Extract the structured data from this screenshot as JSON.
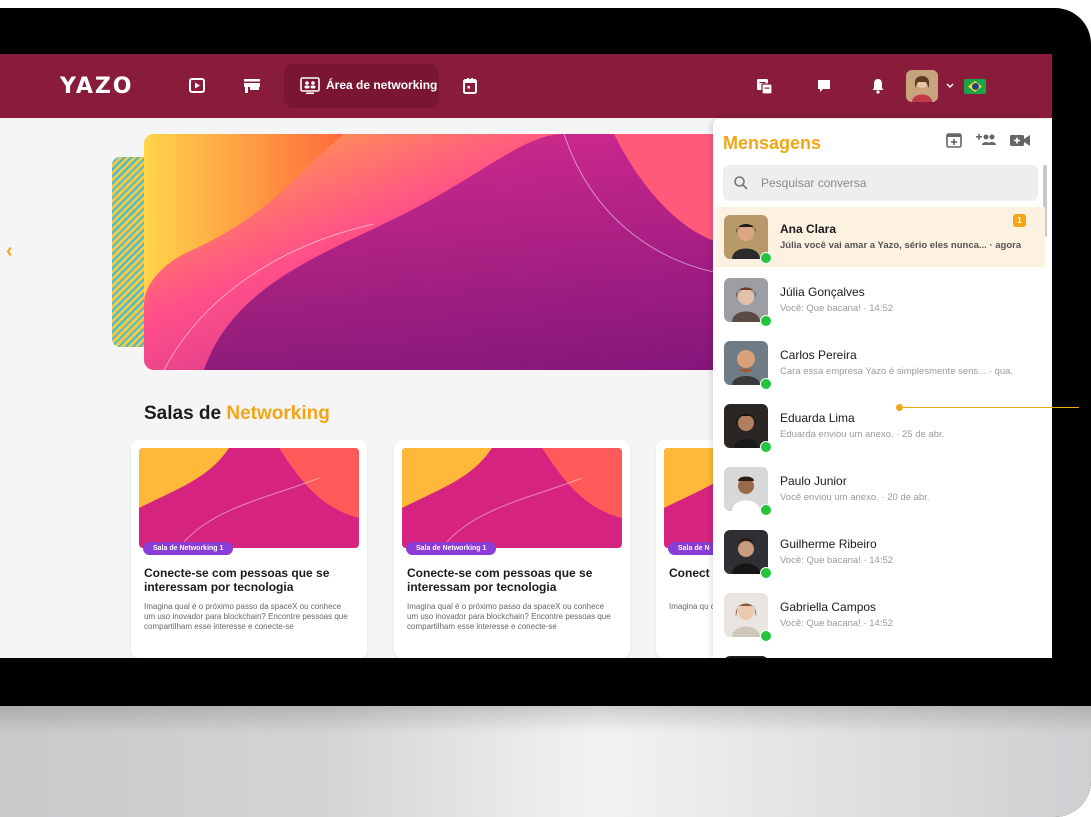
{
  "app": {
    "logo": "YAZO"
  },
  "nav": {
    "active_tab_label": "Área de networking"
  },
  "hero": {
    "slides": 5,
    "active_slide": 1
  },
  "section": {
    "title_start": "Salas de ",
    "title_accent": "Networking"
  },
  "cards": [
    {
      "tag": "Sala de Networking 1",
      "title": "Conecte-se com pessoas que se interessam por tecnologia",
      "desc": "Imagina qual é o próximo passo da spaceX ou conhece um uso inovador para blockchain? Encontre pessoas que compartilham esse interesse e conecte-se"
    },
    {
      "tag": "Sala de Networking 1",
      "title": "Conecte-se com pessoas que se interessam por tecnologia",
      "desc": "Imagina qual é o próximo passo da spaceX ou conhece um uso inovador para blockchain? Encontre pessoas que compartilham esse interesse e conecte-se"
    },
    {
      "tag": "Sala de N",
      "title": "Conect interess",
      "desc": "Imagina qu conhece u Encontre p interesse e"
    }
  ],
  "messages": {
    "title": "Mensagens",
    "search_placeholder": "Pesquisar conversa",
    "conversations": [
      {
        "name": "Ana Clara",
        "preview": "Júlia você vai amar a Yazo, sério eles nunca... · agora",
        "unread": "1",
        "active": true
      },
      {
        "name": "Júlia Gonçalves",
        "preview": "Você: Que bacana! · 14:52"
      },
      {
        "name": "Carlos Pereira",
        "preview": "Cara essa empresa Yazo é simplesmente sens... · qua."
      },
      {
        "name": "Eduarda Lima",
        "preview": "Eduarda enviou um anexo. · 25 de abr."
      },
      {
        "name": "Paulo Junior",
        "preview": "Você enviou um anexo. · 20 de abr."
      },
      {
        "name": "Guilherme Ribeiro",
        "preview": "Você: Que bacana! · 14:52"
      },
      {
        "name": "Gabriella Campos",
        "preview": "Você: Que bacana! · 14:52"
      }
    ]
  },
  "colors": {
    "brand": "#8a1c3b",
    "accent": "#f2a515",
    "online": "#22c53c",
    "tag": "#8a3dd6"
  }
}
